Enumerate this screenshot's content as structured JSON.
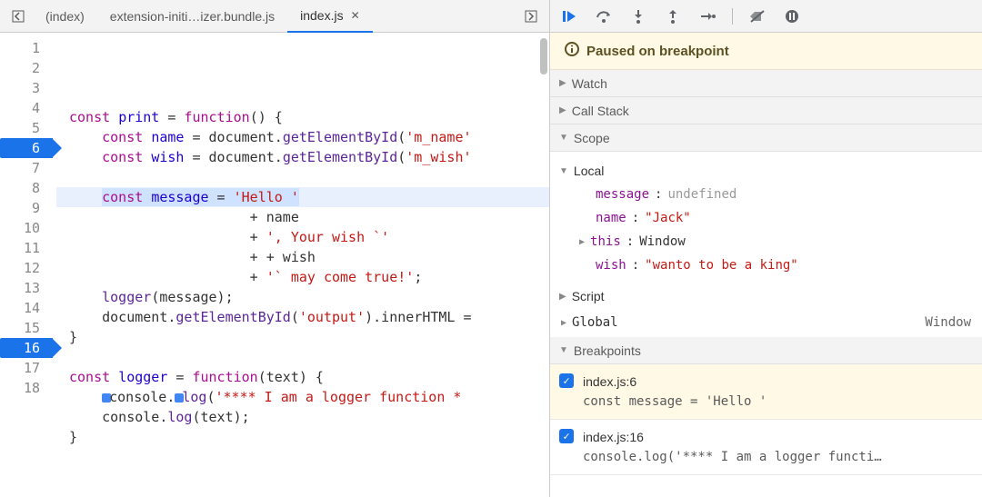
{
  "tabs": {
    "prev_icon": "prev-tab",
    "next_icon": "next-tab",
    "items": [
      {
        "label": "(index)",
        "active": false
      },
      {
        "label": "extension-initi…izer.bundle.js",
        "active": false
      },
      {
        "label": "index.js",
        "active": true
      }
    ]
  },
  "editor": {
    "breakpoint_lines": [
      6,
      16
    ],
    "current_line": 6,
    "lines": [
      {
        "n": 1,
        "html": ""
      },
      {
        "n": 2,
        "html": "<span class='k'>const</span> <span class='id'>print</span> = <span class='k'>function</span>() {"
      },
      {
        "n": 3,
        "html": "    <span class='k'>const</span> <span class='id'>name</span> = document.<span class='fn'>getElementById</span>(<span class='str'>'m_name'</span>"
      },
      {
        "n": 4,
        "html": "    <span class='k'>const</span> <span class='id'>wish</span> = document.<span class='fn'>getElementById</span>(<span class='str'>'m_wish'</span>"
      },
      {
        "n": 5,
        "html": ""
      },
      {
        "n": 6,
        "html": "    <span class='exec-highlight'><span class='k'>const</span> <span class='id'>message</span> = <span class='str'>'Hello '</span></span>"
      },
      {
        "n": 7,
        "html": "                      + name"
      },
      {
        "n": 8,
        "html": "                      + <span class='str'>', Your wish `'</span>"
      },
      {
        "n": 9,
        "html": "                      + + wish"
      },
      {
        "n": 10,
        "html": "                      + <span class='str'>'` may come true!'</span>;"
      },
      {
        "n": 11,
        "html": "    <span class='fn'>logger</span>(message);"
      },
      {
        "n": 12,
        "html": "    document.<span class='fn'>getElementById</span>(<span class='str'>'output'</span>).innerHTML ="
      },
      {
        "n": 13,
        "html": "}"
      },
      {
        "n": 14,
        "html": ""
      },
      {
        "n": 15,
        "html": "<span class='k'>const</span> <span class='id'>logger</span> = <span class='k'>function</span>(text) {"
      },
      {
        "n": 16,
        "html": "    <span class='smallblue'></span>console.<span class='smallblue'></span><span class='fn'>log</span>(<span class='str'>'**** I am a logger function *</span>"
      },
      {
        "n": 17,
        "html": "    console.<span class='fn'>log</span>(text);"
      },
      {
        "n": 18,
        "html": "}"
      }
    ]
  },
  "debugger": {
    "paused_msg": "Paused on breakpoint",
    "toolbar_icons": [
      "resume",
      "step-over",
      "step-into",
      "step-out",
      "step",
      "deactivate-breakpoints",
      "pause-exceptions"
    ],
    "sections": {
      "watch": "Watch",
      "callstack": "Call Stack",
      "scope": "Scope",
      "breakpoints": "Breakpoints"
    },
    "scope": {
      "local_label": "Local",
      "script_label": "Script",
      "global_label": "Global",
      "global_value": "Window",
      "local": [
        {
          "name": "message",
          "value": "undefined",
          "kind": "undef"
        },
        {
          "name": "name",
          "value": "\"Jack\"",
          "kind": "str"
        },
        {
          "name": "this",
          "value": "Window",
          "kind": "obj",
          "expandable": true
        },
        {
          "name": "wish",
          "value": "\"wanto to be a king\"",
          "kind": "str"
        }
      ]
    },
    "breakpoints": [
      {
        "loc": "index.js:6",
        "code": "const message = 'Hello '",
        "active": true
      },
      {
        "loc": "index.js:16",
        "code": "console.log('**** I am a logger functi…",
        "active": false
      }
    ]
  }
}
